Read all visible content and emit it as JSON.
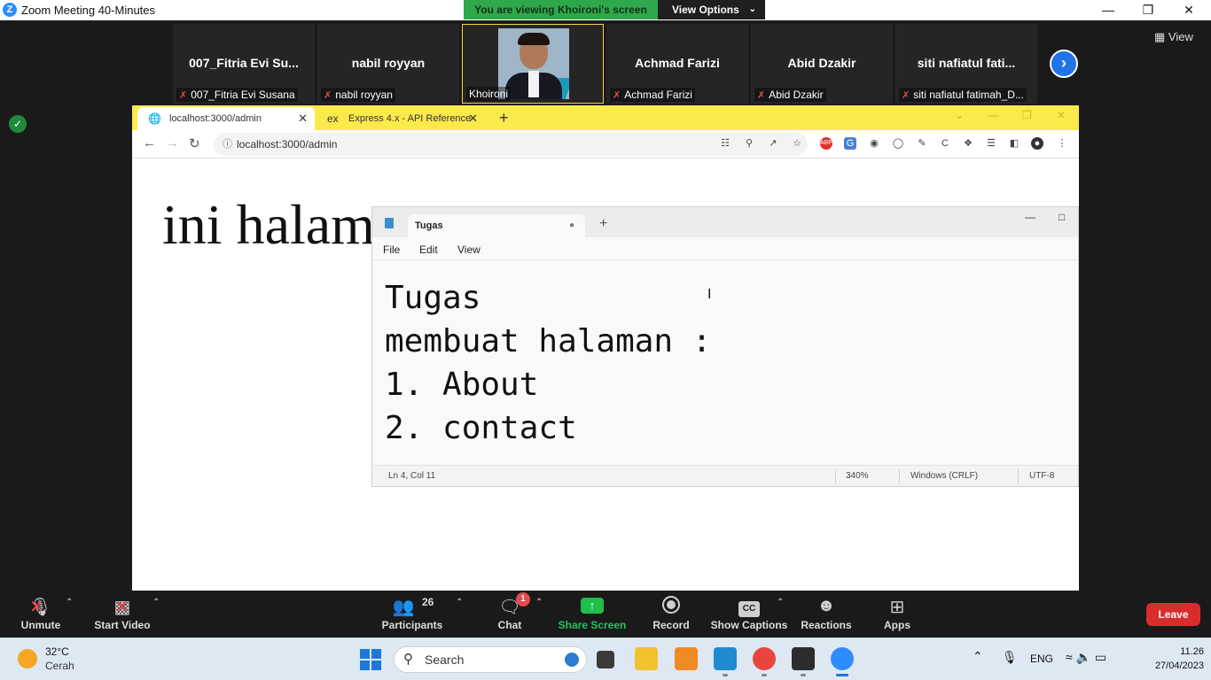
{
  "zoom": {
    "window_title": "Zoom Meeting 40-Minutes",
    "share_banner": "You are viewing Khoironi's screen",
    "view_options": "View Options",
    "view_button": "View",
    "participants": [
      {
        "display": "007_Fitria  Evi  Su...",
        "label": "007_Fitria Evi Susana",
        "muted": true
      },
      {
        "display": "nabil royyan",
        "label": "nabil royyan",
        "muted": true
      },
      {
        "display": "",
        "label": "Khoironi",
        "muted": false,
        "video": true
      },
      {
        "display": "Achmad Farizi",
        "label": "Achmad Farizi",
        "muted": true
      },
      {
        "display": "Abid Dzakir",
        "label": "Abid Dzakir",
        "muted": true
      },
      {
        "display": "siti  nafiatul  fati...",
        "label": "siti nafiatul fatimah_D...",
        "muted": true
      }
    ],
    "controls": {
      "unmute": "Unmute",
      "start_video": "Start Video",
      "participants": "Participants",
      "participants_count": "26",
      "chat": "Chat",
      "chat_badge": "1",
      "share_screen": "Share Screen",
      "record": "Record",
      "captions": "Show Captions",
      "captions_icon": "CC",
      "reactions": "Reactions",
      "apps": "Apps",
      "leave": "Leave"
    }
  },
  "browser": {
    "tabs": [
      {
        "title": "localhost:3000/admin",
        "icon": "globe-icon"
      },
      {
        "title": "Express 4.x - API Reference",
        "icon": "ex"
      }
    ],
    "url": "localhost:3000/admin",
    "page_heading": "ini halam"
  },
  "notepad": {
    "tab_title": "Tugas",
    "menu": [
      "File",
      "Edit",
      "View"
    ],
    "lines": [
      "Tugas",
      "membuat halaman :",
      "1. About",
      "2. contact"
    ],
    "status": {
      "position": "Ln 4, Col 11",
      "zoom": "340%",
      "line_ending": "Windows (CRLF)",
      "encoding": "UTF-8"
    }
  },
  "taskbar": {
    "weather_temp": "32°C",
    "weather_desc": "Cerah",
    "search_placeholder": "Search",
    "language": "ENG",
    "time": "11.26",
    "date": "27/04/2023"
  },
  "colors": {
    "zoom_green": "#2ea84a",
    "chrome_tabstrip": "#fce94a",
    "leave_red": "#d92c2c",
    "zoom_blue": "#2d8cff"
  }
}
